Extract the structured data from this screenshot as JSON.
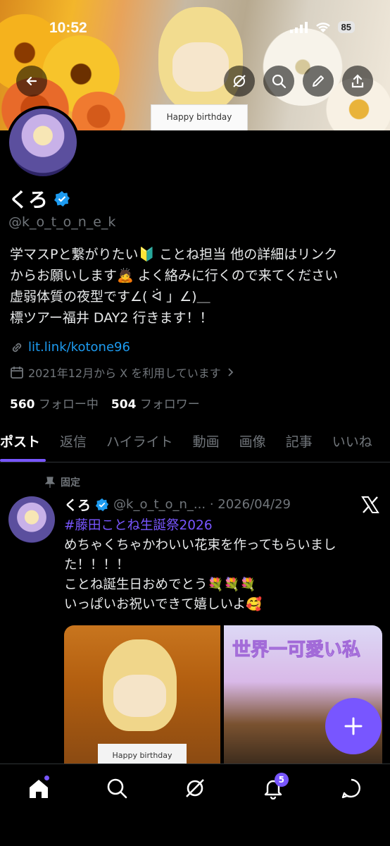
{
  "status_bar": {
    "time": "10:52",
    "battery": "85"
  },
  "banner": {
    "card_text": "Happy birthday"
  },
  "profile": {
    "name": "くろ",
    "handle": "@k_o_t_o_n_e_k",
    "bio_lines": [
      "学マスPと繋がりたい🔰 ことね担当 他の詳細はリンク",
      "からお願いします🙇 よく絡みに行くので来てください",
      "虚弱体質の夜型です∠( ᐛ 」∠)＿",
      "標ツアー福井 DAY2 行きます！！"
    ],
    "link": "lit.link/kotone96",
    "joined": "2021年12月から X を利用しています",
    "following_count": "560",
    "following_label": "フォロー中",
    "followers_count": "504",
    "followers_label": "フォロワー"
  },
  "tabs": [
    "ポスト",
    "返信",
    "ハイライト",
    "動画",
    "画像",
    "記事",
    "いいね"
  ],
  "post": {
    "pinned_label": "固定",
    "name": "くろ",
    "meta": "@k_o_t_o_n_... · 2026/04/29",
    "hashtag": "#藤田ことね生誕祭2026",
    "body_lines": [
      "めちゃくちゃかわいい花束を作ってもらいまし",
      "た！！！！",
      "ことね誕生日おめでとう💐💐💐",
      "いっぱいお祝いできて嬉しいよ🥰"
    ],
    "media1_card": "Happy birthday",
    "media2_title": "世界一可愛い私"
  },
  "nav": {
    "notifications_badge": "5"
  },
  "colors": {
    "accent": "#7856ff",
    "link": "#1d9bf0",
    "muted": "#71767b"
  }
}
